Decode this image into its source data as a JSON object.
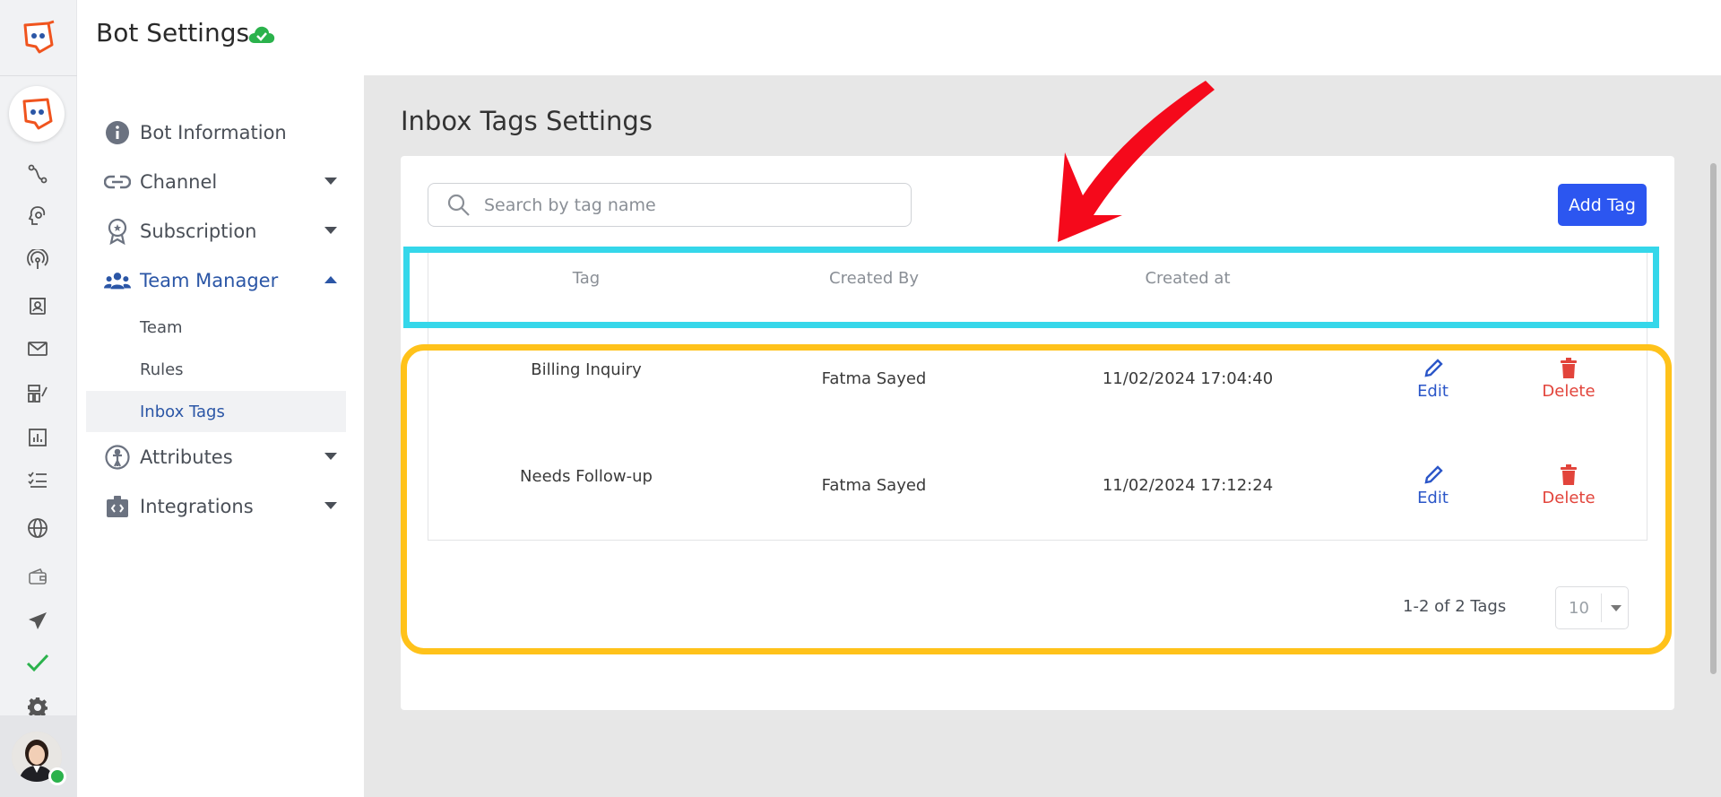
{
  "header": {
    "title": "Bot Settings"
  },
  "nav": {
    "items": [
      {
        "label": "Bot Information"
      },
      {
        "label": "Channel"
      },
      {
        "label": "Subscription"
      },
      {
        "label": "Team Manager"
      },
      {
        "label": "Attributes"
      },
      {
        "label": "Integrations"
      }
    ],
    "sub_items": [
      {
        "label": "Team"
      },
      {
        "label": "Rules"
      },
      {
        "label": "Inbox Tags"
      }
    ]
  },
  "main": {
    "title": "Inbox Tags Settings",
    "search": {
      "placeholder": "Search by tag name",
      "value": ""
    },
    "add_button": "Add Tag",
    "columns": [
      "Tag",
      "Created By",
      "Created at"
    ],
    "rows": [
      {
        "tag": "Billing Inquiry",
        "created_by": "Fatma Sayed",
        "created_at": "11/02/2024 17:04:40",
        "edit": "Edit",
        "delete": "Delete"
      },
      {
        "tag": "Needs Follow-up",
        "created_by": "Fatma Sayed",
        "created_at": "11/02/2024 17:12:24",
        "edit": "Edit",
        "delete": "Delete"
      }
    ],
    "pagination": {
      "summary": "1-2 of 2 Tags",
      "page_size": "10"
    }
  },
  "colors": {
    "brand_orange": "#f0541e",
    "primary_blue": "#2c56f0",
    "delete_red": "#e2443b",
    "annotation_cyan": "#35d7ea",
    "annotation_yellow": "#ffc21a",
    "annotation_arrow": "#f5091b"
  },
  "icons": {
    "rail": [
      "flow-icon",
      "brain-icon",
      "broadcast-icon",
      "contacts-icon",
      "mail-icon",
      "builder-icon",
      "analytics-icon",
      "checklist-icon",
      "globe-icon",
      "wallet-icon",
      "send-icon",
      "check-icon",
      "gear-icon"
    ]
  }
}
